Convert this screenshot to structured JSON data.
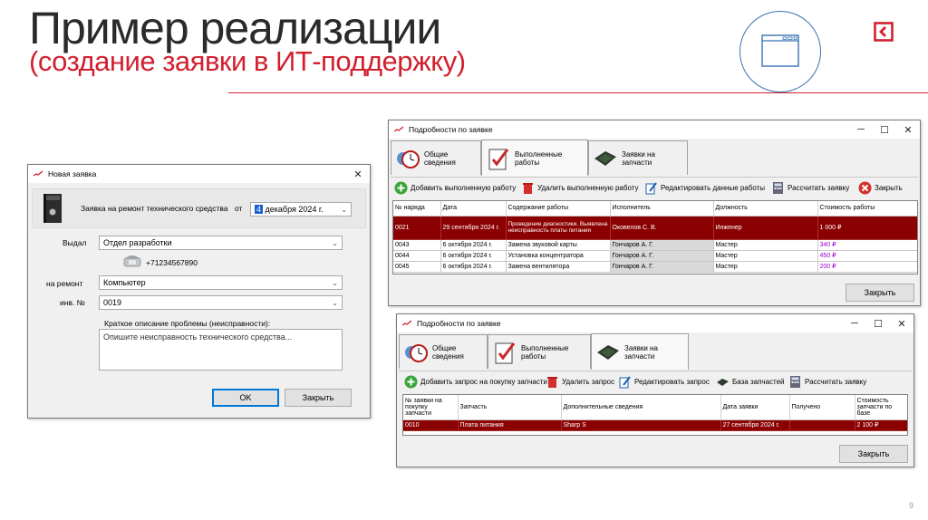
{
  "slide": {
    "title": "Пример реализации",
    "subtitle": "(создание заявки в ИТ-поддержку)",
    "page_number": "9",
    "accent_color": "#d2202f"
  },
  "new_request": {
    "window_title": "Новая заявка",
    "request_label": "Заявка на ремонт технического средства",
    "date_prefix": "от",
    "date_day": "4",
    "date_rest": "декабря  2024 г.",
    "issued_label": "Выдал",
    "issued_value": "Отдел разработки",
    "phone": "+71234567890",
    "repair_label": "на ремонт",
    "repair_value": "Компьютер",
    "inv_label": "инв. №",
    "inv_value": "0019",
    "problem_label": "Краткое описание проблемы (неисправности):",
    "problem_placeholder": "Опишите неисправность технического средства...",
    "ok_label": "OK",
    "close_label": "Закрыть"
  },
  "details_work": {
    "window_title": "Подробности по заявке",
    "tabs": [
      "Общие сведения",
      "Выполненные работы",
      "Заявки на запчасти"
    ],
    "active_tab": 1,
    "toolbar": [
      "Добавить выполненную работу",
      "Удалить выполненную работу",
      "Редактировать данные работы",
      "Рассчитать заявку",
      "Закрыть"
    ],
    "columns": [
      "№ наряда",
      "Дата",
      "Содержание работы",
      "Исполнитель",
      "Должность",
      "Стоимость работы"
    ],
    "rows": [
      [
        "0021",
        "29 сентября 2024 г.",
        "Проведение диагностики. Выявлена неисправность платы питания",
        "Оковелов С. В.",
        "Инженер",
        "1 000 ₽"
      ],
      [
        "0043",
        "6 октября 2024 г.",
        "Замена звуковой карты",
        "Гончаров А. Г.",
        "Мастер",
        "340 ₽"
      ],
      [
        "0044",
        "6 октября 2024 г.",
        "Установка концентратора",
        "Гончаров А. Г.",
        "Мастер",
        "450 ₽"
      ],
      [
        "0045",
        "6 октября 2024 г.",
        "Замена вентилятора",
        "Гончаров А. Г.",
        "Мастер",
        "200 ₽"
      ]
    ],
    "close_label": "Закрыть"
  },
  "details_parts": {
    "window_title": "Подробности по заявке",
    "tabs": [
      "Общие сведения",
      "Выполненные работы",
      "Заявки на запчасти"
    ],
    "active_tab": 2,
    "toolbar": [
      "Добавить запрос на покупку запчасти",
      "Удалить запрос",
      "Редактировать запрос",
      "База запчастей",
      "Рассчитать заявку"
    ],
    "columns": [
      "№ заявки на покупку запчасти",
      "Запчасть",
      "Дополнительные сведения",
      "Дата заявки",
      "Получено",
      "Стоимость запчасти по базе"
    ],
    "rows": [
      [
        "0010",
        "Плата питания",
        "Sharp S",
        "27 сентября 2024 г.",
        "",
        "2 100 ₽"
      ]
    ],
    "close_label": "Закрыть"
  }
}
